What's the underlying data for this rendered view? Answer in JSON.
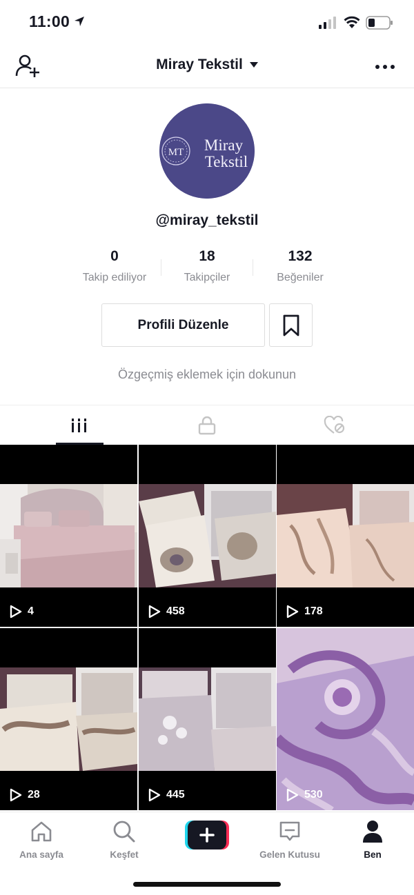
{
  "status_bar": {
    "time": "11:00"
  },
  "header": {
    "title": "Miray Tekstil"
  },
  "profile": {
    "avatar_text_line1": "Miray",
    "avatar_text_line2": "Tekstil",
    "avatar_monogram": "MT",
    "handle": "@miray_tekstil",
    "stats": [
      {
        "value": "0",
        "label": "Takip ediliyor"
      },
      {
        "value": "18",
        "label": "Takipçiler"
      },
      {
        "value": "132",
        "label": "Beğeniler"
      }
    ],
    "edit_button": "Profili Düzenle",
    "bio_prompt": "Özgeçmiş eklemek için dokunun"
  },
  "tabs": [
    {
      "icon": "videos-grid-icon",
      "active": true
    },
    {
      "icon": "lock-icon",
      "active": false
    },
    {
      "icon": "liked-heart-icon",
      "active": false
    }
  ],
  "videos": [
    {
      "views": "4"
    },
    {
      "views": "458"
    },
    {
      "views": "178"
    },
    {
      "views": "28"
    },
    {
      "views": "445"
    },
    {
      "views": "530"
    }
  ],
  "bottom_nav": [
    {
      "label": "Ana sayfa",
      "icon": "home-icon"
    },
    {
      "label": "Keşfet",
      "icon": "search-icon"
    },
    {
      "label": "",
      "icon": "create-plus-icon"
    },
    {
      "label": "Gelen Kutusu",
      "icon": "inbox-icon"
    },
    {
      "label": "Ben",
      "icon": "profile-icon",
      "active": true
    }
  ],
  "colors": {
    "avatar_bg": "#4b4888",
    "accent_cyan": "#20d5ec",
    "accent_pink": "#fe2c55"
  }
}
